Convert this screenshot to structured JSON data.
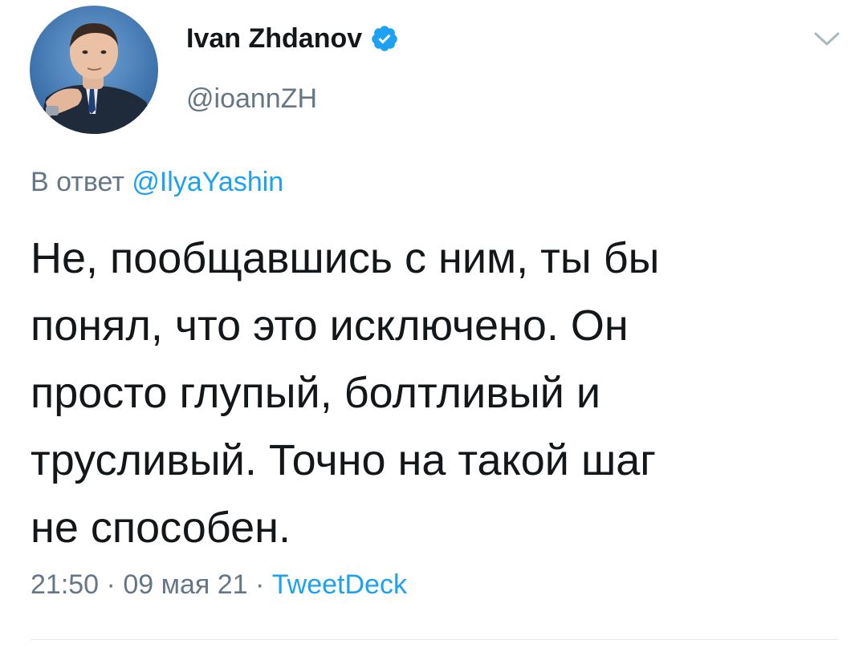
{
  "user": {
    "display_name": "Ivan Zhdanov",
    "handle": "@ioannZH",
    "verified": true,
    "avatar_icon": "user-avatar-photo"
  },
  "reply": {
    "prefix": "В ответ ",
    "mention": "@IlyaYashin"
  },
  "tweet": {
    "text": "Не, пообщавшись с ним, ты бы\nпонял, что это исключено. Он\nпросто глупый, болтливый и\nтрусливый. Точно на такой шаг\nне способен."
  },
  "meta": {
    "time": "21:50",
    "sep1": " · ",
    "date": "09 мая 21",
    "sep2": " · ",
    "source": "TweetDeck"
  },
  "icons": {
    "verified": "verified-badge-icon",
    "caret": "chevron-down-icon"
  },
  "colors": {
    "accent": "#1da1f2",
    "secondary_text": "#657786",
    "primary_text": "#14171a",
    "divider": "#e1e8ed"
  }
}
